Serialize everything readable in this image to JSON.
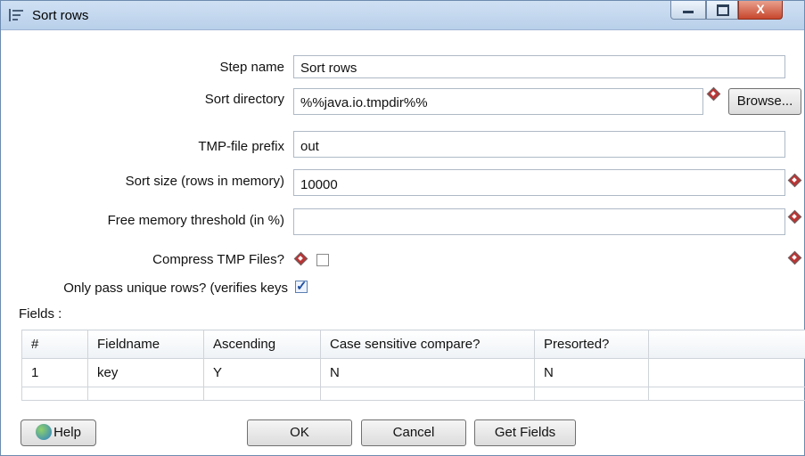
{
  "window": {
    "title": "Sort rows",
    "close_label": "X"
  },
  "form": {
    "step_name": {
      "label": "Step name",
      "value": "Sort rows"
    },
    "sort_directory": {
      "label": "Sort directory",
      "value": "%%java.io.tmpdir%%"
    },
    "browse_label": "Browse...",
    "tmp_prefix": {
      "label": "TMP-file prefix",
      "value": "out"
    },
    "sort_size": {
      "label": "Sort size (rows in memory)",
      "value": "10000"
    },
    "free_memory": {
      "label": "Free memory threshold (in %)",
      "value": ""
    },
    "compress": {
      "label": "Compress TMP Files?",
      "checked": false
    },
    "unique_rows": {
      "label": "Only pass unique rows? (verifies keys",
      "checked": true
    }
  },
  "fields": {
    "label": "Fields :",
    "columns": [
      "#",
      "Fieldname",
      "Ascending",
      "Case sensitive compare?",
      "Presorted?",
      ""
    ],
    "rows": [
      [
        "1",
        "key",
        "Y",
        "N",
        "N",
        ""
      ]
    ]
  },
  "buttons": {
    "help": "Help",
    "ok": "OK",
    "cancel": "Cancel",
    "get_fields": "Get Fields"
  }
}
